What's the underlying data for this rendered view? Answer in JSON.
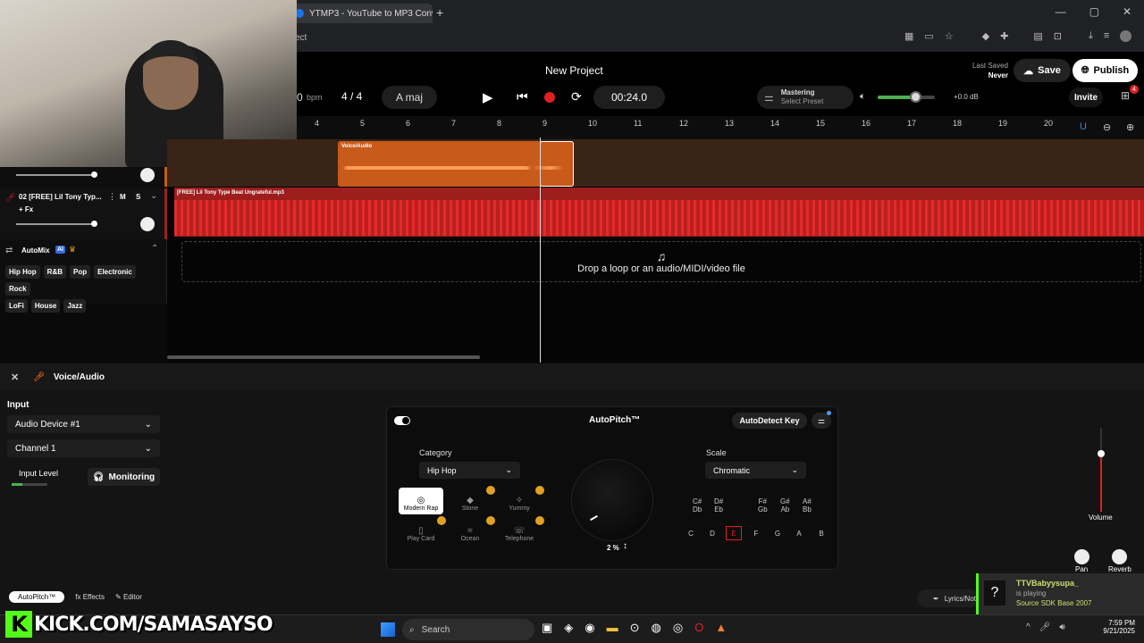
{
  "browser": {
    "tab_title": "YTMP3 - YouTube to MP3 Conv",
    "url_fragment": "ect",
    "window_controls": [
      "—",
      "▢",
      "✕"
    ]
  },
  "header": {
    "project_title": "New Project",
    "last_saved_label": "Last Saved",
    "last_saved_value": "Never",
    "save_label": "Save",
    "publish_label": "Publish",
    "invite_label": "Invite",
    "gift_badge": "4"
  },
  "transport": {
    "bpm_value": "0",
    "bpm_label": "bpm",
    "time_signature": "4 / 4",
    "key": "A maj",
    "time": "00:24.0",
    "mastering_label": "Mastering",
    "mastering_preset": "Select Preset",
    "volume_db": "+0.0 dB"
  },
  "ruler": [
    "4",
    "5",
    "6",
    "7",
    "8",
    "9",
    "10",
    "11",
    "12",
    "13",
    "14",
    "15",
    "16",
    "17",
    "18",
    "19",
    "20"
  ],
  "tracks": {
    "track2_name": "02  [FREE] Lil Tony Typ...",
    "track2_fx": "+ Fx",
    "mute": "M",
    "solo": "S",
    "clip1_name": "Voice/Audio",
    "clip2_name": "[FREE] Lil Tony Type Beat Ungrateful.mp3",
    "drop_text": "Drop a loop or an audio/MIDI/video file"
  },
  "automix": {
    "label": "AutoMix",
    "ai_badge": "AI",
    "genres": [
      "Hip Hop",
      "R&B",
      "Pop",
      "Electronic",
      "Rock",
      "LoFi",
      "House",
      "Jazz"
    ]
  },
  "panel": {
    "title": "Voice/Audio",
    "input_label": "Input",
    "device": "Audio Device #1",
    "channel": "Channel 1",
    "input_level": "Input Level",
    "monitoring": "Monitoring",
    "volume_label": "Volume",
    "pan_label": "Pan",
    "reverb_label": "Reverb"
  },
  "autopitch": {
    "title": "AutoPitch™",
    "autodetect": "AutoDetect Key",
    "category_label": "Category",
    "category_value": "Hip Hop",
    "scale_label": "Scale",
    "scale_value": "Chromatic",
    "knob_value": "2 %",
    "styles": [
      "Modern Rap",
      "Stone",
      "Yummy",
      "Play Card",
      "Ocean",
      "Telephone"
    ],
    "sharps": [
      "C#\nDb",
      "D#\nEb",
      "F#\nGb",
      "G#\nAb",
      "A#\nBb"
    ],
    "naturals": [
      "C",
      "D",
      "E",
      "F",
      "G",
      "A",
      "B"
    ]
  },
  "bottom_tabs": [
    "AutoPitch™",
    "Effects",
    "Editor",
    "Lyrics/Not"
  ],
  "overlay": {
    "kick_text": "KICK.COM/SAMASAYSO",
    "notif_user": "TTVBabyysupa_",
    "notif_status": "is playing",
    "notif_game": "Source SDK Base 2007"
  },
  "taskbar": {
    "search": "Search",
    "time": "7:59 PM",
    "date": "9/21/2025"
  },
  "colors": {
    "accent_orange": "#c85a1a",
    "track_red": "#9e1d1d",
    "kick_green": "#53fc18",
    "record_red": "#e02020"
  }
}
